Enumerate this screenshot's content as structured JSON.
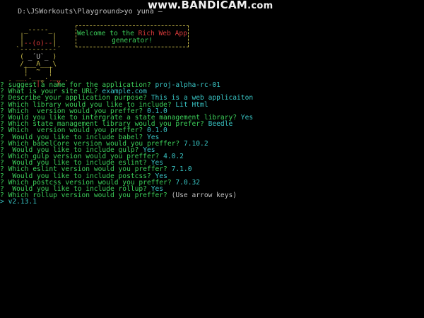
{
  "terminal": {
    "prompt_line": "D:\\JSWorkouts\\Playground>yo yuna ",
    "prompt_suffix": "—",
    "watermark_main": "www.BANDICAM",
    "watermark_tld": ".com"
  },
  "banner": {
    "art": {
      "row1": "     _-----_",
      "row2a": "    |       |",
      "row3a": "    |",
      "row3b": "--(o)--",
      "row3c": "|",
      "row4a": "   `---------´",
      "row5a": "    ( ",
      "row5b": "_´U`_",
      "row5c": " )",
      "row6a": "    /___A___\\",
      "row7a": "     |  ~  |",
      "row8a": "   __'.___.'__",
      "row9a": " ´   ",
      "row9b": "`  |",
      "row9c": "° ",
      "row9d": "´ Y",
      "row9e": " `"
    },
    "welcome_part1": "Welcome to the ",
    "welcome_highlight": "Rich Web App",
    "welcome_part2": " generator!"
  },
  "qa": [
    {
      "prefix": "? ",
      "question": "suggest a name for the application?",
      "answer": "proj-alpha-rc-01"
    },
    {
      "prefix": "? ",
      "question": "What is your site URL?",
      "answer": "example.com"
    },
    {
      "prefix": "? ",
      "question": "Describe your application purpose?",
      "answer": "This is a web applicaiton"
    },
    {
      "prefix": "? ",
      "question": "Which library would you like to include?",
      "answer": "Lit Html"
    },
    {
      "prefix": "? ",
      "question": "Which  version would you preffer?",
      "answer": "0.1.0"
    },
    {
      "prefix": "? ",
      "question": "Would you like to intergrate a state management library?",
      "answer": "Yes"
    },
    {
      "prefix": "? ",
      "question": "Which state management library would you prefer?",
      "answer": "Beedle"
    },
    {
      "prefix": "? ",
      "question": "Which  version would you preffer?",
      "answer": "0.1.0"
    },
    {
      "prefix": "? ",
      "question": " Would you like to include babel?",
      "answer": "Yes"
    },
    {
      "prefix": "? ",
      "question": "Which babelCore version would you preffer?",
      "answer": "7.10.2"
    },
    {
      "prefix": "? ",
      "question": " Would you like to include gulp?",
      "answer": "Yes"
    },
    {
      "prefix": "? ",
      "question": "Which gulp version would you preffer?",
      "answer": "4.0.2"
    },
    {
      "prefix": "? ",
      "question": " Would you like to include eslint?",
      "answer": "Yes"
    },
    {
      "prefix": "? ",
      "question": "Which eslint version would you preffer?",
      "answer": "7.1.0"
    },
    {
      "prefix": "? ",
      "question": " Would you like to include postcss?",
      "answer": "Yes"
    },
    {
      "prefix": "? ",
      "question": "Which postcss version would you preffer?",
      "answer": "7.0.32"
    },
    {
      "prefix": "? ",
      "question": " Would you like to include rollup?",
      "answer": "Yes"
    }
  ],
  "active_question": {
    "prefix": "? ",
    "question": "Which rollup version would you preffer?",
    "hint": "(Use arrow keys)"
  },
  "selected_option": {
    "pointer": "> ",
    "value": "v2.13.1"
  },
  "colors": {
    "background": "#000000",
    "question": "#3cd05a",
    "answer": "#39c6c6",
    "yeoman_yellow": "#c7b94a",
    "yeoman_red": "#d83a3a"
  }
}
